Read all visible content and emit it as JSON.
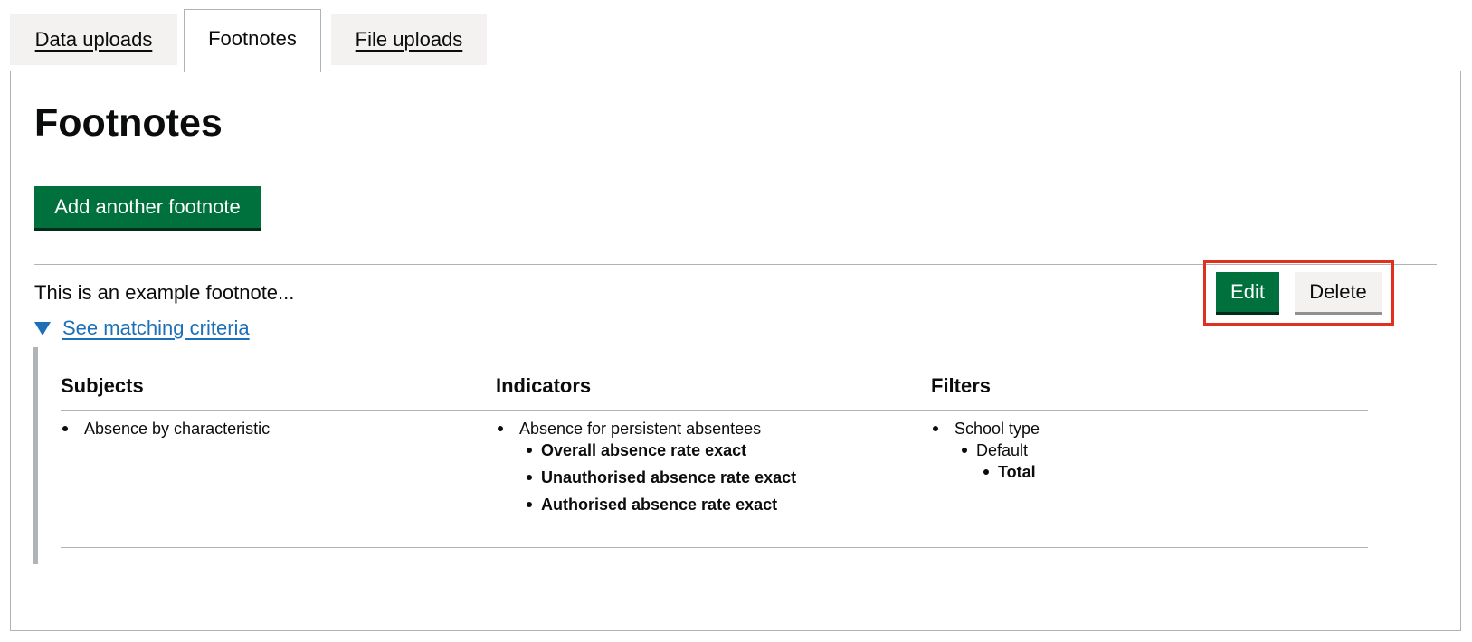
{
  "tabs": [
    {
      "label": "Data uploads"
    },
    {
      "label": "Footnotes"
    },
    {
      "label": "File uploads"
    }
  ],
  "page_title": "Footnotes",
  "add_button_label": "Add another footnote",
  "footnote": {
    "text": "This is an example footnote...",
    "edit_label": "Edit",
    "delete_label": "Delete",
    "criteria_toggle": "See matching criteria"
  },
  "criteria": {
    "subjects": {
      "heading": "Subjects",
      "items": [
        "Absence by characteristic"
      ]
    },
    "indicators": {
      "heading": "Indicators",
      "group": "Absence for persistent absentees",
      "items": [
        "Overall absence rate exact",
        "Unauthorised absence rate exact",
        "Authorised absence rate exact"
      ]
    },
    "filters": {
      "heading": "Filters",
      "filter": "School type",
      "group": "Default",
      "item": "Total"
    }
  },
  "colors": {
    "primary_button": "#00703c",
    "link": "#1d70b8",
    "highlight": "#e0301e"
  }
}
